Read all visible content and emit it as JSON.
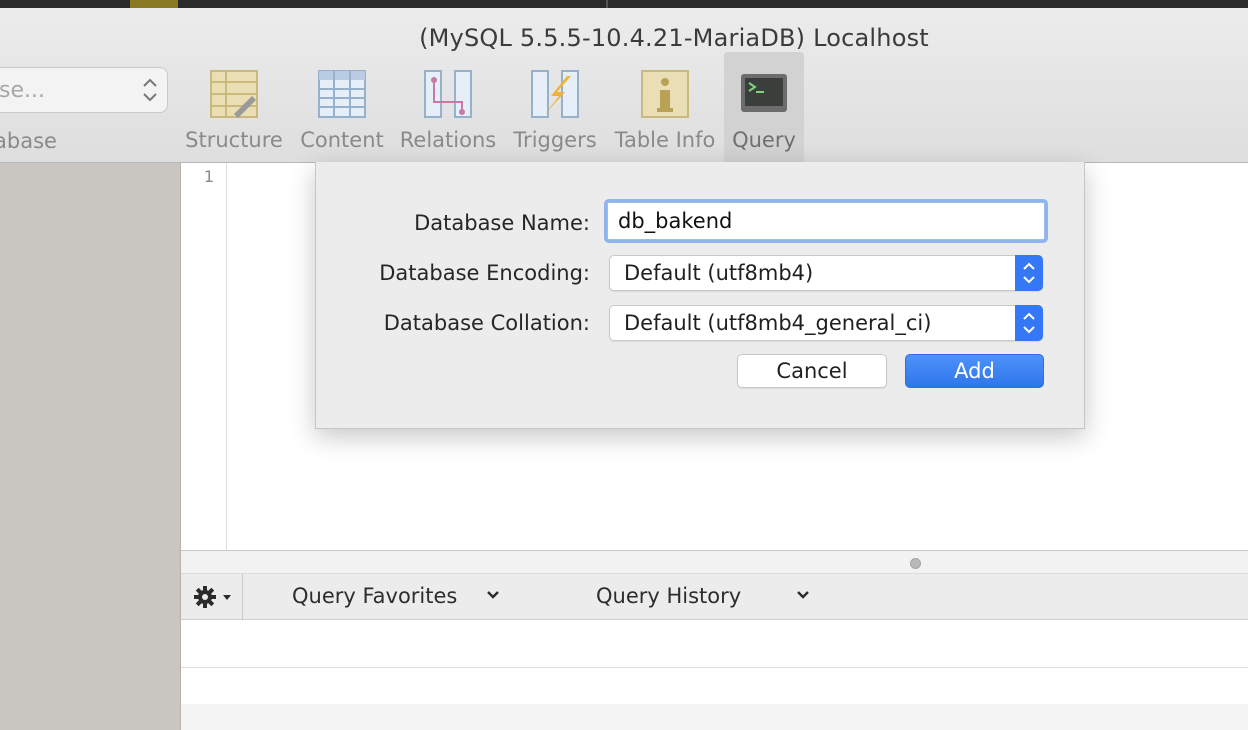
{
  "window": {
    "title": "(MySQL 5.5.5-10.4.21-MariaDB) Localhost"
  },
  "toolbar": {
    "database_select": {
      "placeholder": "se...",
      "label": "abase"
    },
    "buttons": [
      {
        "label": "Structure",
        "icon": "structure-icon"
      },
      {
        "label": "Content",
        "icon": "content-icon"
      },
      {
        "label": "Relations",
        "icon": "relations-icon"
      },
      {
        "label": "Triggers",
        "icon": "triggers-icon"
      },
      {
        "label": "Table Info",
        "icon": "table-info-icon"
      },
      {
        "label": "Query",
        "icon": "query-icon",
        "active": true
      }
    ]
  },
  "editor": {
    "line_numbers": [
      "1"
    ]
  },
  "query_bar": {
    "favorites": "Query Favorites",
    "history": "Query History"
  },
  "dialog": {
    "name_label": "Database Name:",
    "name_value": "db_bakend",
    "encoding_label": "Database Encoding:",
    "encoding_value": "Default (utf8mb4)",
    "collation_label": "Database Collation:",
    "collation_value": "Default (utf8mb4_general_ci)",
    "cancel": "Cancel",
    "add": "Add"
  },
  "colors": {
    "accent": "#3478f6",
    "focus_ring": "#8fb4ee"
  }
}
